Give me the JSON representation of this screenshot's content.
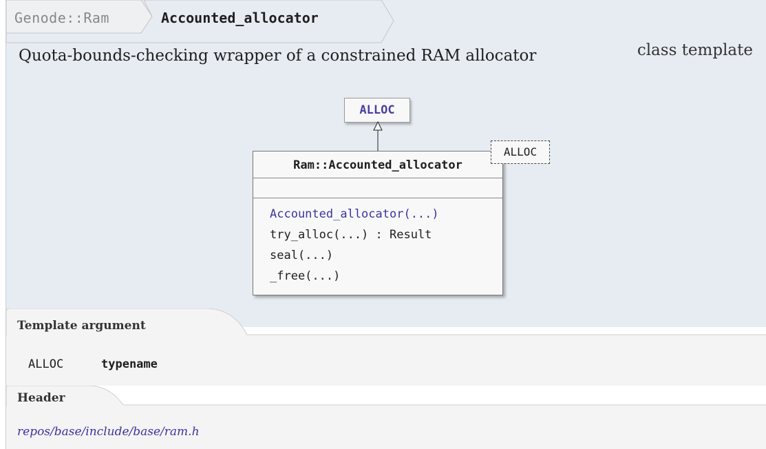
{
  "breadcrumb": {
    "namespace": "Genode::Ram",
    "class_name": "Accounted_allocator"
  },
  "description": "Quota-bounds-checking wrapper of a constrained RAM allocator",
  "kind": "class template",
  "diagram": {
    "base_class": "ALLOC",
    "class_title": "Ram::Accounted_allocator",
    "template_param": "ALLOC",
    "operations": [
      {
        "text": "Accounted_allocator(...)",
        "link": true
      },
      {
        "text": "try_alloc(...) : Result",
        "link": false
      },
      {
        "text": "seal(...)",
        "link": false
      },
      {
        "text": "_free(...)",
        "link": false
      }
    ]
  },
  "template_argument": {
    "heading": "Template argument",
    "name": "ALLOC",
    "type": "typename"
  },
  "header": {
    "heading": "Header",
    "path": "repos/base/include/base/ram.h"
  },
  "colors": {
    "panel_bg": "#e7ecf2",
    "link": "#3d32a0"
  }
}
